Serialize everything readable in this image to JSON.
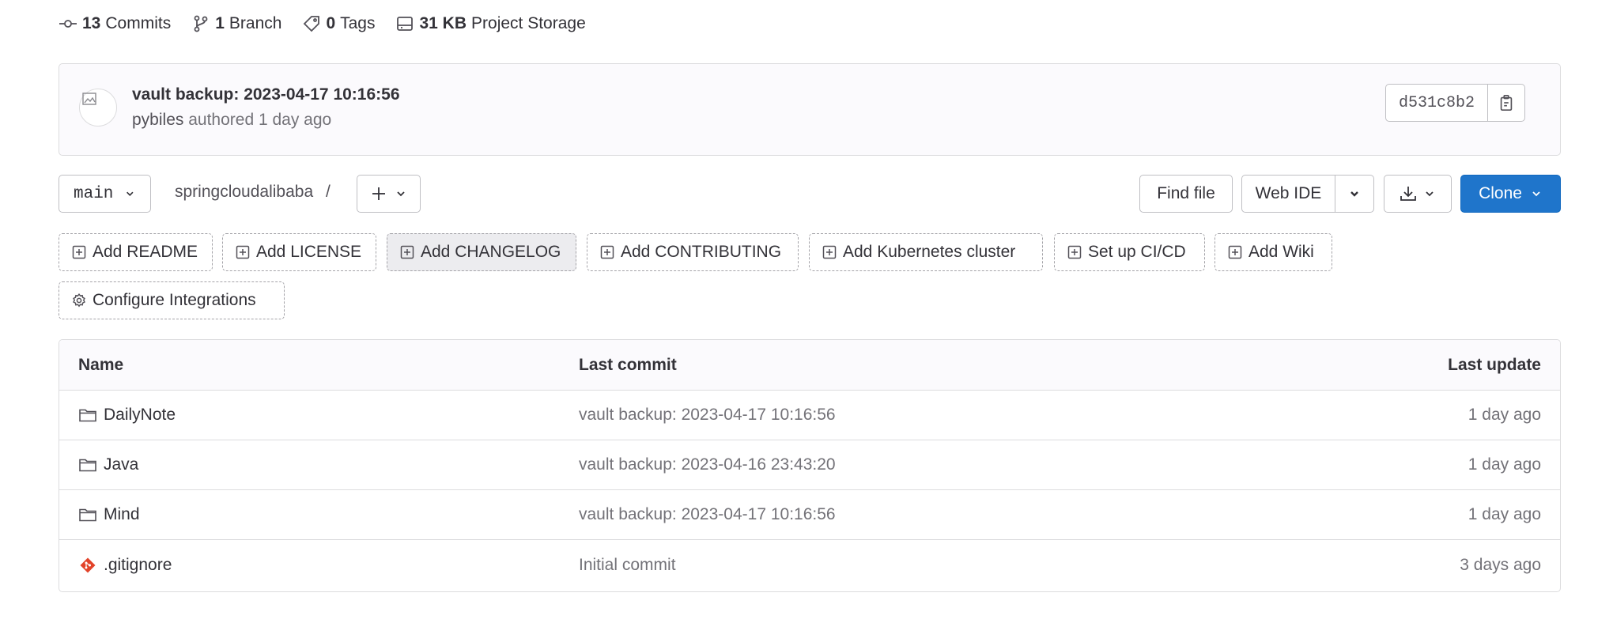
{
  "stats": {
    "commits_count": "13",
    "commits_label": "Commits",
    "branch_count": "1",
    "branch_label": "Branch",
    "tags_count": "0",
    "tags_label": "Tags",
    "storage_size": "31 KB",
    "storage_label": "Project Storage"
  },
  "last_commit": {
    "title": "vault backup: 2023-04-17 10:16:56",
    "author": "pybiles",
    "meta": "authored 1 day ago",
    "sha": "d531c8b2"
  },
  "nav": {
    "branch": "main",
    "repo_path": "springcloudalibaba",
    "separator": "/",
    "find_file": "Find file",
    "web_ide": "Web IDE",
    "clone": "Clone"
  },
  "suggestions": [
    {
      "label": "Add README",
      "icon": "plus-square-icon"
    },
    {
      "label": "Add LICENSE",
      "icon": "plus-square-icon"
    },
    {
      "label": "Add CHANGELOG",
      "icon": "plus-square-icon"
    },
    {
      "label": "Add CONTRIBUTING",
      "icon": "plus-square-icon"
    },
    {
      "label": "Add Kubernetes cluster",
      "icon": "plus-square-icon"
    },
    {
      "label": "Set up CI/CD",
      "icon": "plus-square-icon"
    },
    {
      "label": "Add Wiki",
      "icon": "plus-square-icon"
    },
    {
      "label": "Configure Integrations",
      "icon": "settings-icon"
    }
  ],
  "table": {
    "headers": {
      "name": "Name",
      "last_commit": "Last commit",
      "last_update": "Last update"
    },
    "rows": [
      {
        "name": "DailyNote",
        "type": "folder",
        "commit": "vault backup: 2023-04-17 10:16:56",
        "updated": "1 day ago"
      },
      {
        "name": "Java",
        "type": "folder",
        "commit": "vault backup: 2023-04-16 23:43:20",
        "updated": "1 day ago"
      },
      {
        "name": "Mind",
        "type": "folder",
        "commit": "vault backup: 2023-04-17 10:16:56",
        "updated": "1 day ago"
      },
      {
        "name": ".gitignore",
        "type": "git-file",
        "commit": "Initial commit",
        "updated": "3 days ago"
      }
    ]
  },
  "colors": {
    "primary_blue": "#1f75cb",
    "git_orange": "#e24329",
    "text": "#333238",
    "muted": "#737278"
  }
}
